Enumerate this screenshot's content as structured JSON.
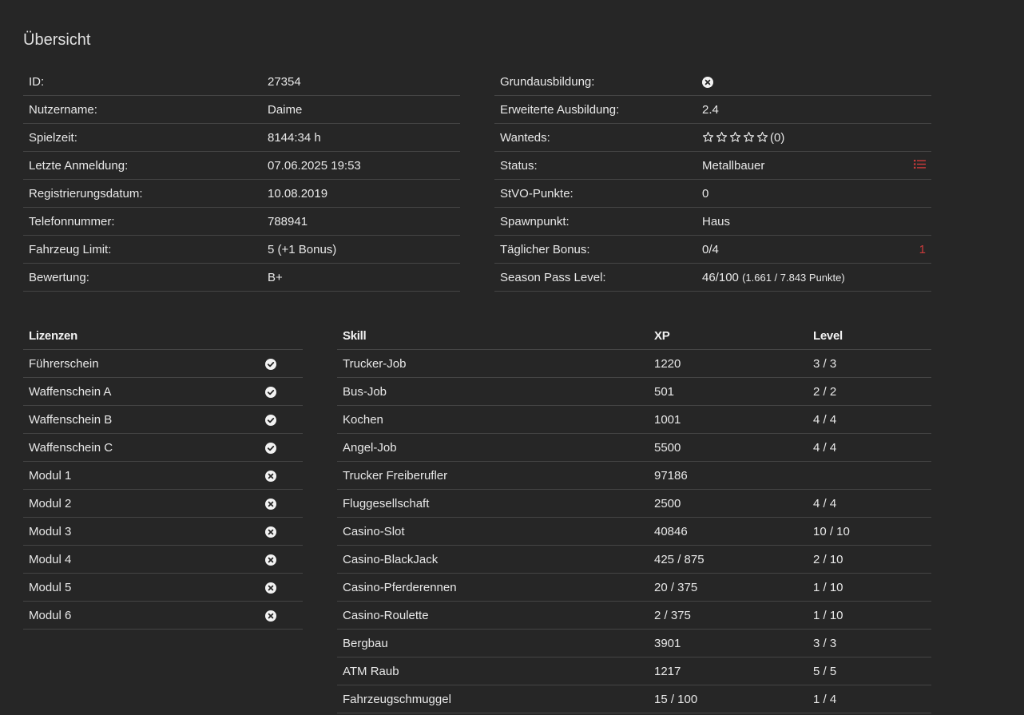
{
  "page_title": "Übersicht",
  "left_info": [
    {
      "label": "ID:",
      "value": "27354"
    },
    {
      "label": "Nutzername:",
      "value": "Daime"
    },
    {
      "label": "Spielzeit:",
      "value": "8144:34 h"
    },
    {
      "label": "Letzte Anmeldung:",
      "value": "07.06.2025 19:53"
    },
    {
      "label": "Registrierungsdatum:",
      "value": "10.08.2019"
    },
    {
      "label": "Telefonnummer:",
      "value": "788941"
    },
    {
      "label": "Fahrzeug Limit:",
      "value": "5 (+1 Bonus)"
    },
    {
      "label": "Bewertung:",
      "value": "B+"
    }
  ],
  "right_info": {
    "grundausbildung": {
      "label": "Grundausbildung:",
      "icon": "x-circle-icon"
    },
    "erweiterte": {
      "label": "Erweiterte Ausbildung:",
      "value": "2.4"
    },
    "wanteds": {
      "label": "Wanteds:",
      "stars": 5,
      "filled": 0,
      "count": "(0)"
    },
    "status": {
      "label": "Status:",
      "value": "Metallbauer",
      "icon": "list-icon"
    },
    "stvo": {
      "label": "StVO-Punkte:",
      "value": "0"
    },
    "spawn": {
      "label": "Spawnpunkt:",
      "value": "Haus"
    },
    "bonus": {
      "label": "Täglicher Bonus:",
      "value": "0/4",
      "extra": "1"
    },
    "season": {
      "label": "Season Pass Level:",
      "value": "46/100",
      "detail": "(1.661 / 7.843 Punkte)"
    }
  },
  "licenses": {
    "header": "Lizenzen",
    "items": [
      {
        "name": "Führerschein",
        "has": true
      },
      {
        "name": "Waffenschein A",
        "has": true
      },
      {
        "name": "Waffenschein B",
        "has": true
      },
      {
        "name": "Waffenschein C",
        "has": true
      },
      {
        "name": "Modul 1",
        "has": false
      },
      {
        "name": "Modul 2",
        "has": false
      },
      {
        "name": "Modul 3",
        "has": false
      },
      {
        "name": "Modul 4",
        "has": false
      },
      {
        "name": "Modul 5",
        "has": false
      },
      {
        "name": "Modul 6",
        "has": false
      }
    ]
  },
  "skills": {
    "headers": {
      "skill": "Skill",
      "xp": "XP",
      "level": "Level"
    },
    "rows": [
      {
        "skill": "Trucker-Job",
        "xp": "1220",
        "level": "3 / 3"
      },
      {
        "skill": "Bus-Job",
        "xp": "501",
        "level": "2 / 2"
      },
      {
        "skill": "Kochen",
        "xp": "1001",
        "level": "4 / 4"
      },
      {
        "skill": "Angel-Job",
        "xp": "5500",
        "level": "4 / 4"
      },
      {
        "skill": "Trucker Freiberufler",
        "xp": "97186",
        "level": ""
      },
      {
        "skill": "Fluggesellschaft",
        "xp": "2500",
        "level": "4 / 4"
      },
      {
        "skill": "Casino-Slot",
        "xp": "40846",
        "level": "10 / 10"
      },
      {
        "skill": "Casino-BlackJack",
        "xp": "425 / 875",
        "level": "2 / 10"
      },
      {
        "skill": "Casino-Pferderennen",
        "xp": "20 / 375",
        "level": "1 / 10"
      },
      {
        "skill": "Casino-Roulette",
        "xp": "2 / 375",
        "level": "1 / 10"
      },
      {
        "skill": "Bergbau",
        "xp": "3901",
        "level": "3 / 3"
      },
      {
        "skill": "ATM Raub",
        "xp": "1217",
        "level": "5 / 5"
      },
      {
        "skill": "Fahrzeugschmuggel",
        "xp": "15 / 100",
        "level": "1 / 4"
      }
    ]
  },
  "colors": {
    "background": "#262626",
    "accent_red": "#cc3b3b",
    "divider": "#454545"
  }
}
